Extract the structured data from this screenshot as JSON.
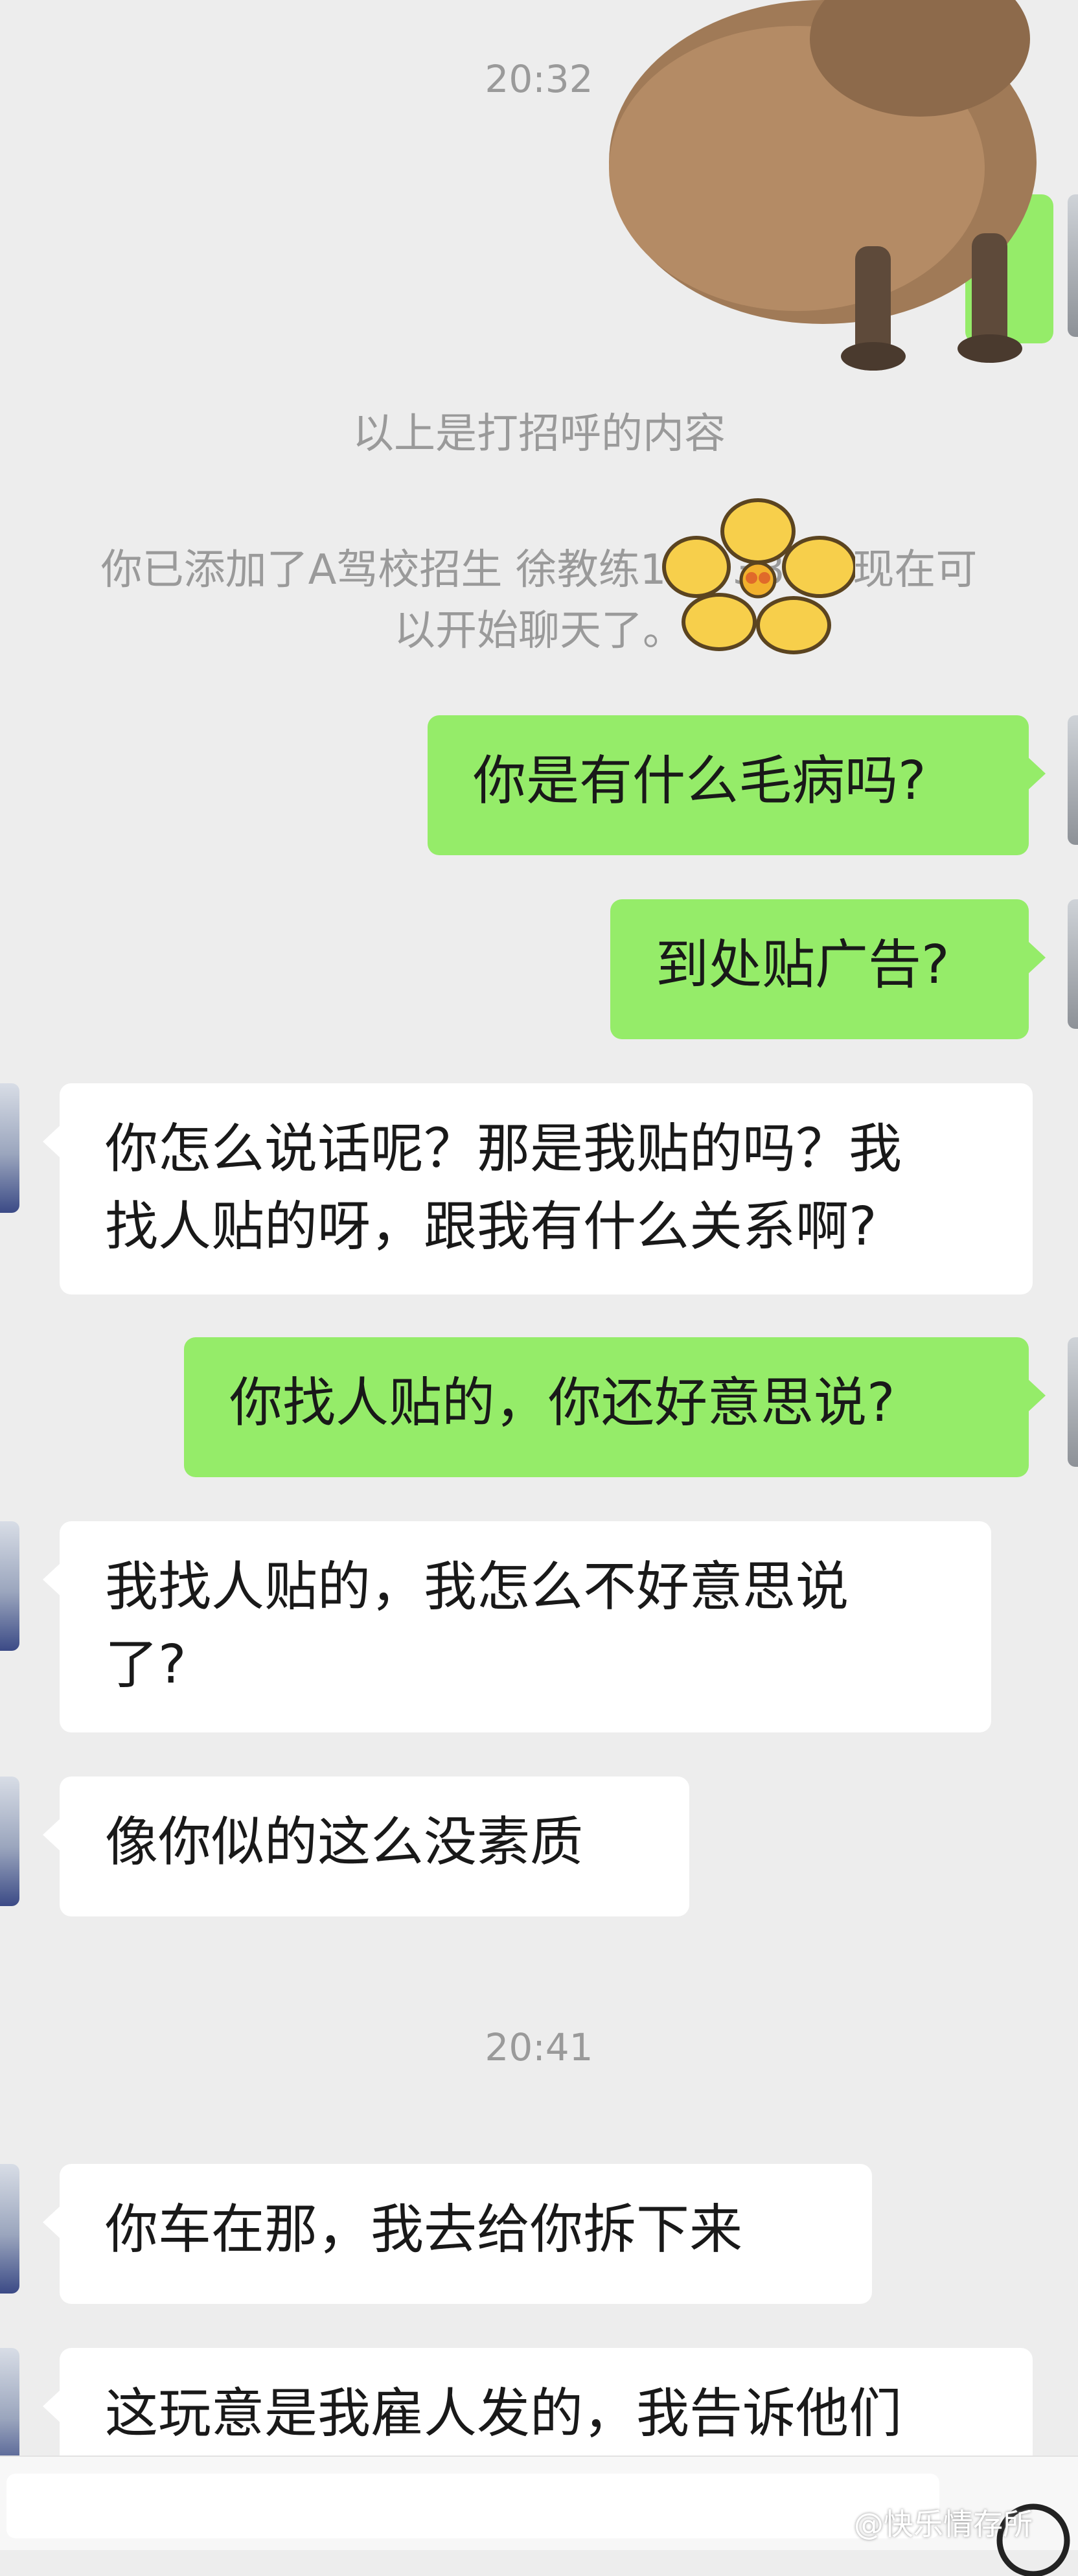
{
  "chat": {
    "timestamp_1": "20:32",
    "system_greeting": "以上是打招呼的内容",
    "system_added_line1": "你已添加了A驾校招生  徐教练18  3333，现在可",
    "system_added_line2": "以开始聊天了。",
    "timestamp_2": "20:41",
    "messages": [
      {
        "from": "me",
        "lines": [
          "你是有什么毛病吗?"
        ]
      },
      {
        "from": "me",
        "lines": [
          "到处贴广告?"
        ]
      },
      {
        "from": "them",
        "lines": [
          "你怎么说话呢？那是我贴的吗？我",
          "找人贴的呀，跟我有什么关系啊?"
        ]
      },
      {
        "from": "me",
        "lines": [
          "你找人贴的，你还好意思说?"
        ]
      },
      {
        "from": "them",
        "lines": [
          "我找人贴的，我怎么不好意思说",
          "了?"
        ]
      },
      {
        "from": "them",
        "lines": [
          "像你似的这么没素质"
        ]
      },
      {
        "from": "them",
        "lines": [
          "你车在那，我去给你拆下来"
        ]
      },
      {
        "from": "them",
        "lines": [
          "这玩意是我雇人发的，我告诉他们"
        ]
      }
    ]
  },
  "stickers": {
    "capybara": "capybara-sticker",
    "flower": "flower-sticker"
  },
  "watermark": "@快乐情存所",
  "colors": {
    "background": "#ededed",
    "my_bubble": "#95ec69",
    "their_bubble": "#ffffff",
    "system_text": "#9a9a9a"
  }
}
